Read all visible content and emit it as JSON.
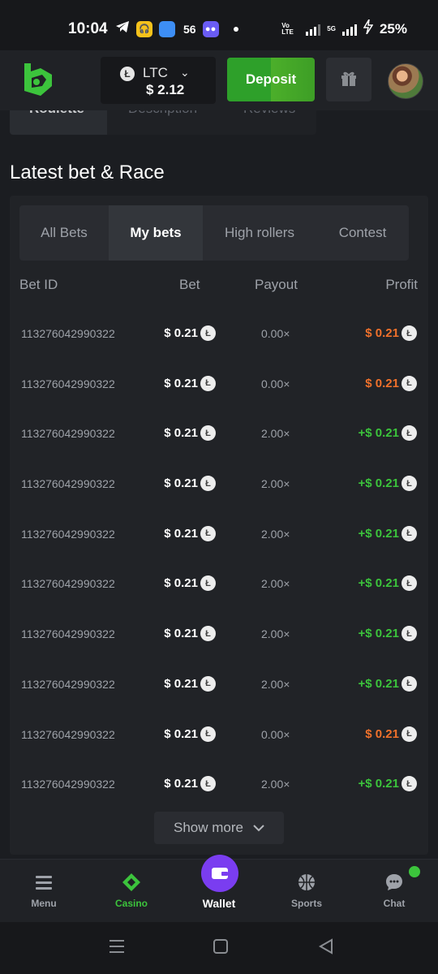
{
  "status": {
    "time": "10:04",
    "notif_count": "56",
    "net_label": "Vo LTE",
    "net5g": "5G",
    "battery": "25%"
  },
  "header": {
    "currency": "LTC",
    "balance": "$ 2.12",
    "deposit_label": "Deposit"
  },
  "top_tabs": [
    "Roulette",
    "Description",
    "Reviews"
  ],
  "section_title": "Latest bet & Race",
  "filter_tabs": [
    "All Bets",
    "My bets",
    "High rollers",
    "Contest"
  ],
  "table": {
    "headers": [
      "Bet ID",
      "Bet",
      "Payout",
      "Profit"
    ],
    "rows": [
      {
        "id": "113276042990322",
        "bet": "$ 0.21",
        "payout": "0.00×",
        "profit": "$ 0.21",
        "win": false
      },
      {
        "id": "113276042990322",
        "bet": "$ 0.21",
        "payout": "0.00×",
        "profit": "$ 0.21",
        "win": false
      },
      {
        "id": "113276042990322",
        "bet": "$ 0.21",
        "payout": "2.00×",
        "profit": "+$ 0.21",
        "win": true
      },
      {
        "id": "113276042990322",
        "bet": "$ 0.21",
        "payout": "2.00×",
        "profit": "+$ 0.21",
        "win": true
      },
      {
        "id": "113276042990322",
        "bet": "$ 0.21",
        "payout": "2.00×",
        "profit": "+$ 0.21",
        "win": true
      },
      {
        "id": "113276042990322",
        "bet": "$ 0.21",
        "payout": "2.00×",
        "profit": "+$ 0.21",
        "win": true
      },
      {
        "id": "113276042990322",
        "bet": "$ 0.21",
        "payout": "2.00×",
        "profit": "+$ 0.21",
        "win": true
      },
      {
        "id": "113276042990322",
        "bet": "$ 0.21",
        "payout": "2.00×",
        "profit": "+$ 0.21",
        "win": true
      },
      {
        "id": "113276042990322",
        "bet": "$ 0.21",
        "payout": "0.00×",
        "profit": "$ 0.21",
        "win": false
      },
      {
        "id": "113276042990322",
        "bet": "$ 0.21",
        "payout": "2.00×",
        "profit": "+$ 0.21",
        "win": true
      }
    ],
    "show_more": "Show more"
  },
  "bottom_nav": [
    "Menu",
    "Casino",
    "Wallet",
    "Sports",
    "Chat"
  ],
  "colors": {
    "accent_green": "#3cc43c",
    "loss_orange": "#f0712b",
    "wallet_purple": "#7a3df0",
    "background": "#1b1d21"
  }
}
